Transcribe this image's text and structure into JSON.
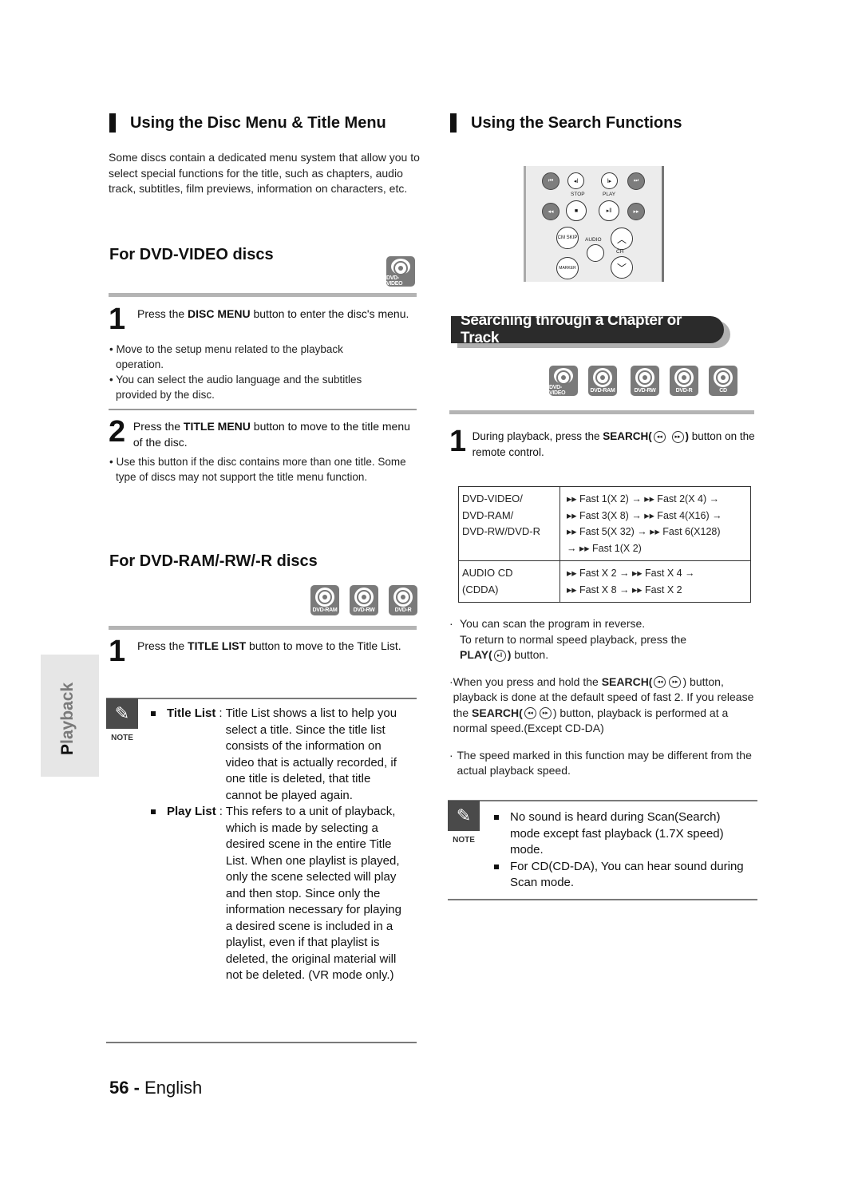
{
  "left": {
    "section_title": "Using the Disc Menu & Title Menu",
    "intro": "Some discs contain a dedicated menu system that allow you to select special functions for the title, such as chapters, audio track, subtitles, film previews, information on characters, etc.",
    "dvd_video": {
      "heading": "For DVD-VIDEO discs",
      "icon_label": "DVD-VIDEO",
      "step1": {
        "num": "1",
        "pre": "Press the ",
        "bold": "DISC MENU",
        "post": " button to enter the disc's menu."
      },
      "bullets": [
        "• Move to the setup menu related to the playback operation.",
        "• You can select the audio language and the subtitles provided by the disc."
      ],
      "step2": {
        "num": "2",
        "pre": "Press the ",
        "bold": "TITLE MENU",
        "post": " button to move to the title menu of the disc."
      },
      "step2_bullet": "• Use this button if the disc contains more than one title. Some type of discs may not support the title menu function."
    },
    "dvd_ram": {
      "heading": "For DVD-RAM/-RW/-R discs",
      "icons": [
        "DVD-RAM",
        "DVD-RW",
        "DVD-R"
      ],
      "step1": {
        "num": "1",
        "pre": "Press the ",
        "bold": "TITLE LIST",
        "post": " button to move to the Title List."
      }
    },
    "note": {
      "label": "NOTE",
      "items": [
        {
          "term": "Title List",
          "desc": "Title List shows a list to help you select a title. Since the title list consists of the information on video that is actually recorded, if one title is deleted, that title cannot be played again."
        },
        {
          "term": "Play List",
          "desc": "This refers to a unit of playback, which is made by selecting a desired scene in the entire Title List. When one playlist is played, only the scene selected will play and then stop. Since only the information necessary for playing a desired scene is included in a playlist, even if that playlist is deleted, the original material will not be deleted. (VR mode only.)"
        }
      ]
    }
  },
  "side_tab": {
    "first": "P",
    "rest": "layback"
  },
  "footer": {
    "page": "56",
    "sep": " - ",
    "lang": "English"
  },
  "right": {
    "section_title": "Using the Search Functions",
    "remote": {
      "labels": {
        "stop": "STOP",
        "play": "PLAY",
        "cm_skip": "CM SKIP",
        "audio": "AUDIO",
        "ch": "CH",
        "marker": "MARKER"
      }
    },
    "banner": "Searching through a Chapter or Track",
    "icons": [
      "DVD-VIDEO",
      "DVD-RAM",
      "DVD-RW",
      "DVD-R",
      "CD"
    ],
    "step1": {
      "num": "1",
      "pre": "During playback, press the ",
      "bold": "SEARCH(",
      "bold_end": ")",
      "post": " button on the remote control."
    },
    "table": {
      "rows": [
        {
          "disc": [
            "DVD-VIDEO/",
            "DVD-RAM/",
            "DVD-RW/DVD-R"
          ],
          "speeds": [
            "▸▸ Fast 1(X 2) → ▸▸ Fast 2(X 4) →",
            "▸▸ Fast 3(X 8) → ▸▸ Fast 4(X16) →",
            "▸▸ Fast 5(X 32) → ▸▸ Fast 6(X128)",
            "→ ▸▸ Fast 1(X 2)"
          ]
        },
        {
          "disc": [
            "AUDIO CD",
            "(CDDA)"
          ],
          "speeds": [
            "▸▸ Fast X 2 → ▸▸ Fast X 4 →",
            "▸▸ Fast X 8 → ▸▸ Fast X 2"
          ]
        }
      ]
    },
    "bullets": {
      "b1_line1": "You can scan the program in reverse.",
      "b1_line2": "To return to normal speed playback, press the",
      "b1_play": "PLAY(",
      "b1_play_end": ")",
      "b1_tail": " button.",
      "b2_pre": "When you press and hold the ",
      "b2_bold": "SEARCH(",
      "b2_mid": " button, playback is done at the default speed of fast 2. If you release the ",
      "b2_bold2": "SEARCH(",
      "b2_post": " button, playback is performed at a normal speed.(Except CD-DA)",
      "b3": "The speed marked in this function may be different from the actual playback speed."
    },
    "note": {
      "label": "NOTE",
      "items": [
        "No sound is heard during Scan(Search) mode except fast playback (1.7X speed) mode.",
        "For CD(CD-DA), You can hear sound during Scan mode."
      ]
    }
  }
}
